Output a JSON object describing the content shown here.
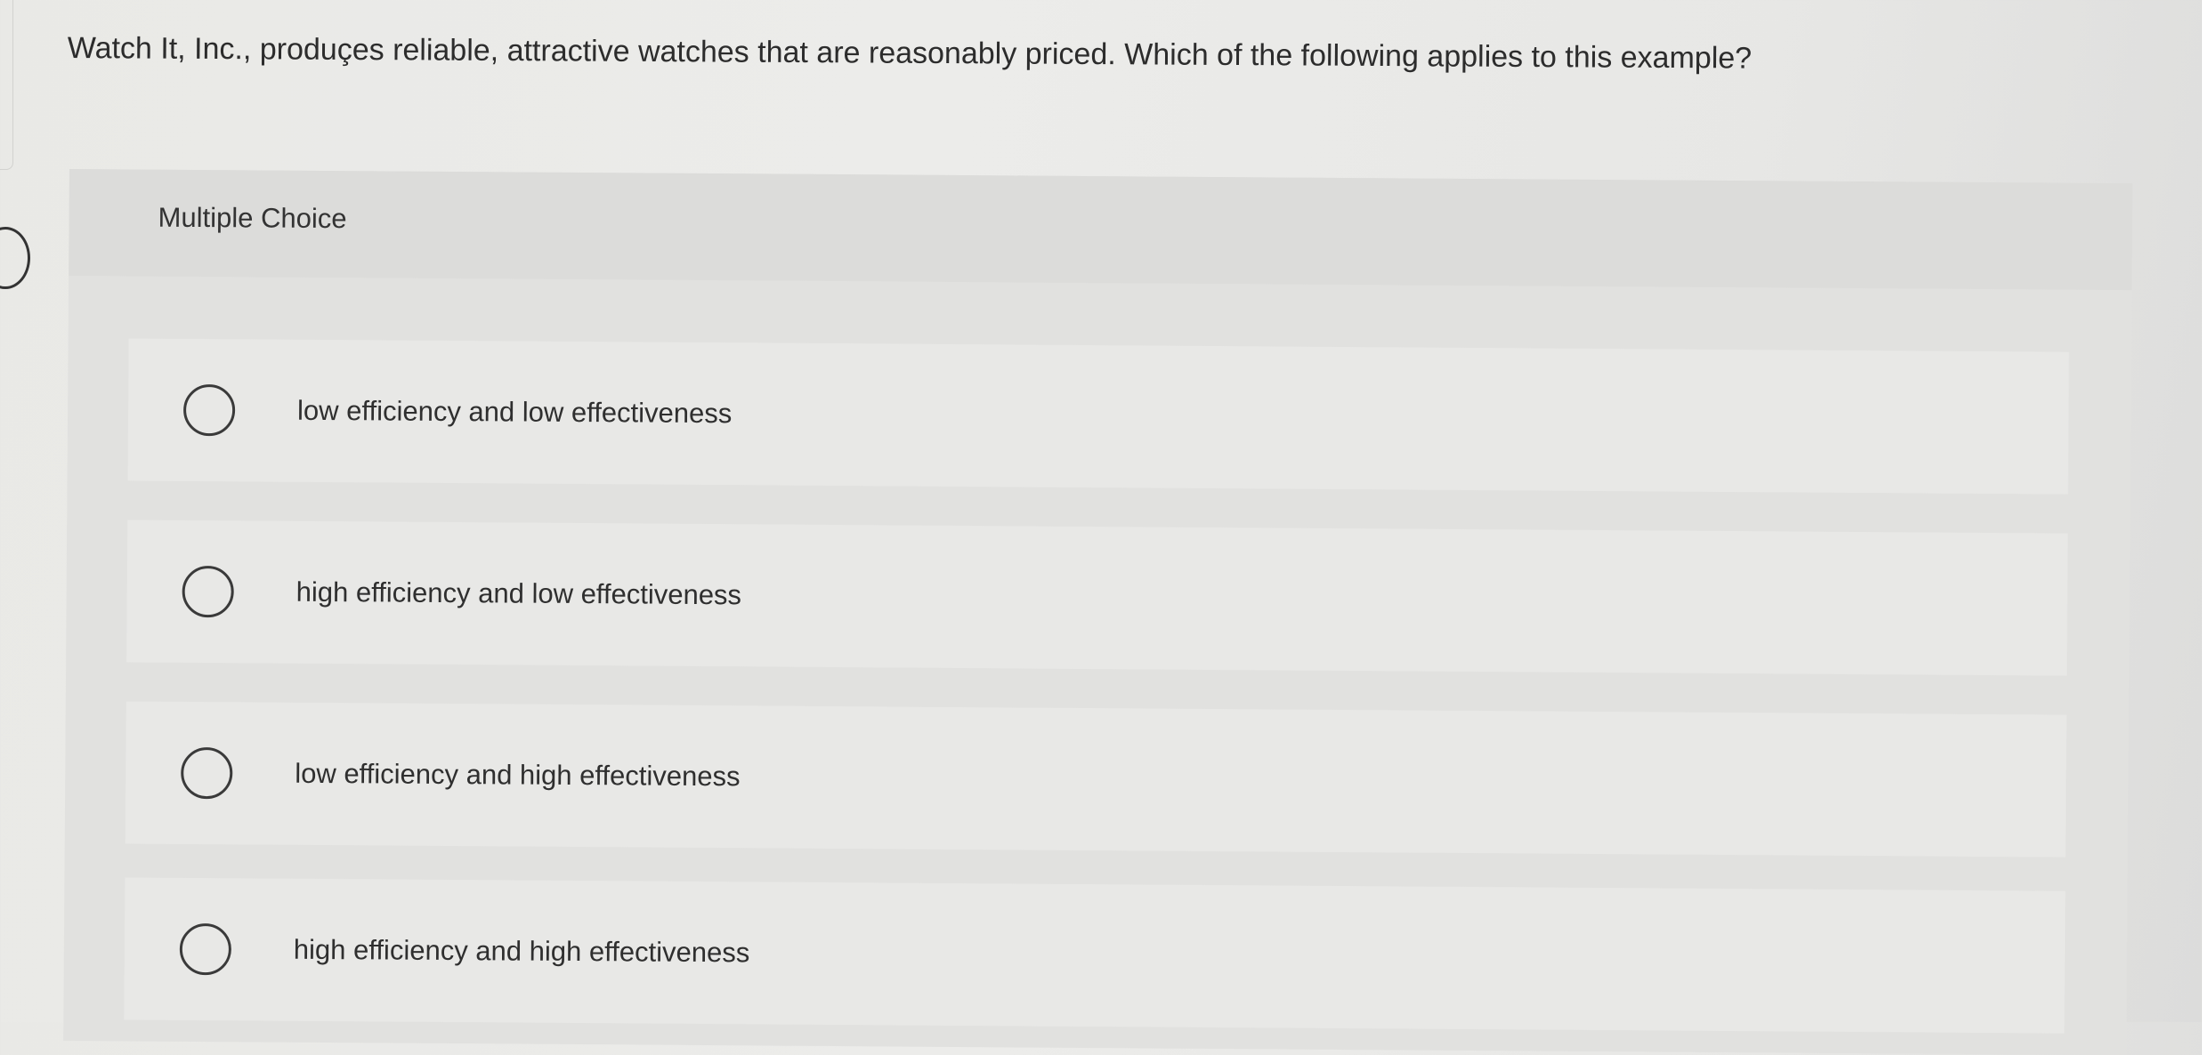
{
  "question": {
    "text": "Watch It, Inc., produçes reliable, attractive watches that are reasonably priced. Which of the following applies to this example?"
  },
  "panel": {
    "title": "Multiple Choice"
  },
  "options": [
    {
      "label": "low efficiency and low effectiveness",
      "selected": false
    },
    {
      "label": "high efficiency and low effectiveness",
      "selected": false
    },
    {
      "label": "low efficiency and high effectiveness",
      "selected": false
    },
    {
      "label": "high efficiency and high effectiveness",
      "selected": false
    }
  ]
}
